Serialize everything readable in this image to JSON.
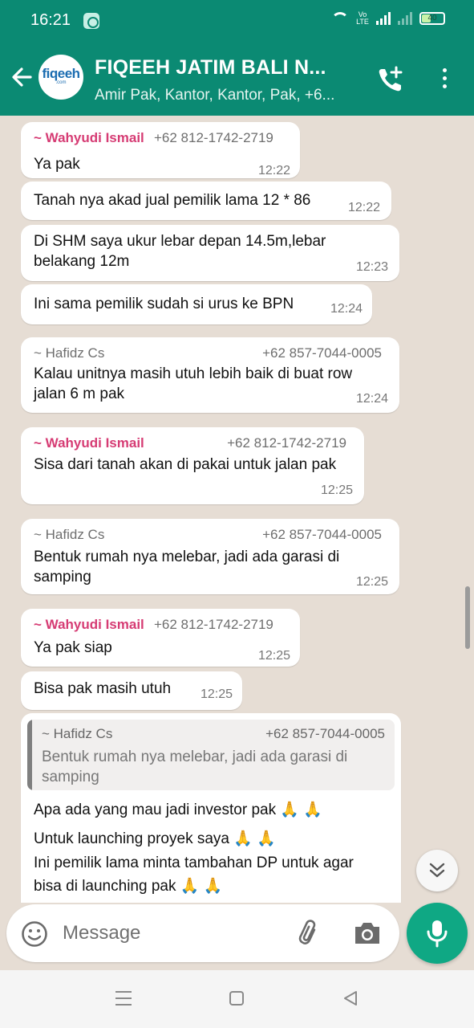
{
  "status_bar": {
    "time": "16:21",
    "volte": "Vo LTE",
    "battery": "40"
  },
  "header": {
    "title": "FIQEEH JATIM BALI N...",
    "subtitle": "Amir Pak, Kantor, Kantor, Pak, +6...",
    "avatar_text": "fiqeeh",
    "avatar_sub": ".com",
    "call_icon": "add-call-icon",
    "menu_icon": "more-vert-icon"
  },
  "colors": {
    "header_bg": "#0b8a73",
    "sender_pink": "#d63c74",
    "mic_bg": "#0fa884"
  },
  "messages": [
    {
      "sender": "~ Wahyudi Ismail",
      "phone": "+62 812-1742-2719",
      "text": "Ya pak",
      "time": "12:22"
    },
    {
      "text": "Tanah nya akad jual pemilik lama 12 * 86",
      "time": "12:22"
    },
    {
      "text_line1": "Di SHM saya ukur lebar depan 14.5m,lebar",
      "text_line2": "belakang 12m",
      "time": "12:23"
    },
    {
      "text": "Ini sama pemilik sudah si urus ke BPN",
      "time": "12:24"
    },
    {
      "sender": "~ Hafidz Cs",
      "phone": "+62 857-7044-0005",
      "text_line1": "Kalau unitnya masih utuh lebih baik di buat row",
      "text_line2": "jalan 6 m pak",
      "time": "12:24"
    },
    {
      "sender": "~ Wahyudi Ismail",
      "phone": "+62 812-1742-2719",
      "text": "Sisa dari tanah akan di pakai untuk jalan pak",
      "time": "12:25"
    },
    {
      "sender": "~ Hafidz Cs",
      "phone": "+62 857-7044-0005",
      "text_line1": "Bentuk rumah nya melebar, jadi ada garasi di",
      "text_line2": "samping",
      "time": "12:25"
    },
    {
      "sender": "~ Wahyudi Ismail",
      "phone": "+62 812-1742-2719",
      "text": "Ya pak siap",
      "time": "12:25"
    },
    {
      "text": "Bisa pak masih utuh",
      "time": "12:25"
    },
    {
      "quote_sender": "~ Hafidz Cs",
      "quote_phone": "+62 857-7044-0005",
      "quote_line1": "Bentuk rumah nya melebar, jadi ada garasi di",
      "quote_line2": "samping",
      "line1": "Apa ada yang mau jadi investor pak 🙏 🙏",
      "line2": "Untuk launching proyek saya 🙏 🙏",
      "line3": "Ini pemilik lama minta tambahan DP untuk agar",
      "line4": "bisa di launching pak 🙏 🙏"
    }
  ],
  "composer": {
    "placeholder": "Message",
    "emoji_icon": "emoji-icon",
    "attach_icon": "paperclip-icon",
    "camera_icon": "camera-icon",
    "mic_icon": "microphone-icon"
  }
}
